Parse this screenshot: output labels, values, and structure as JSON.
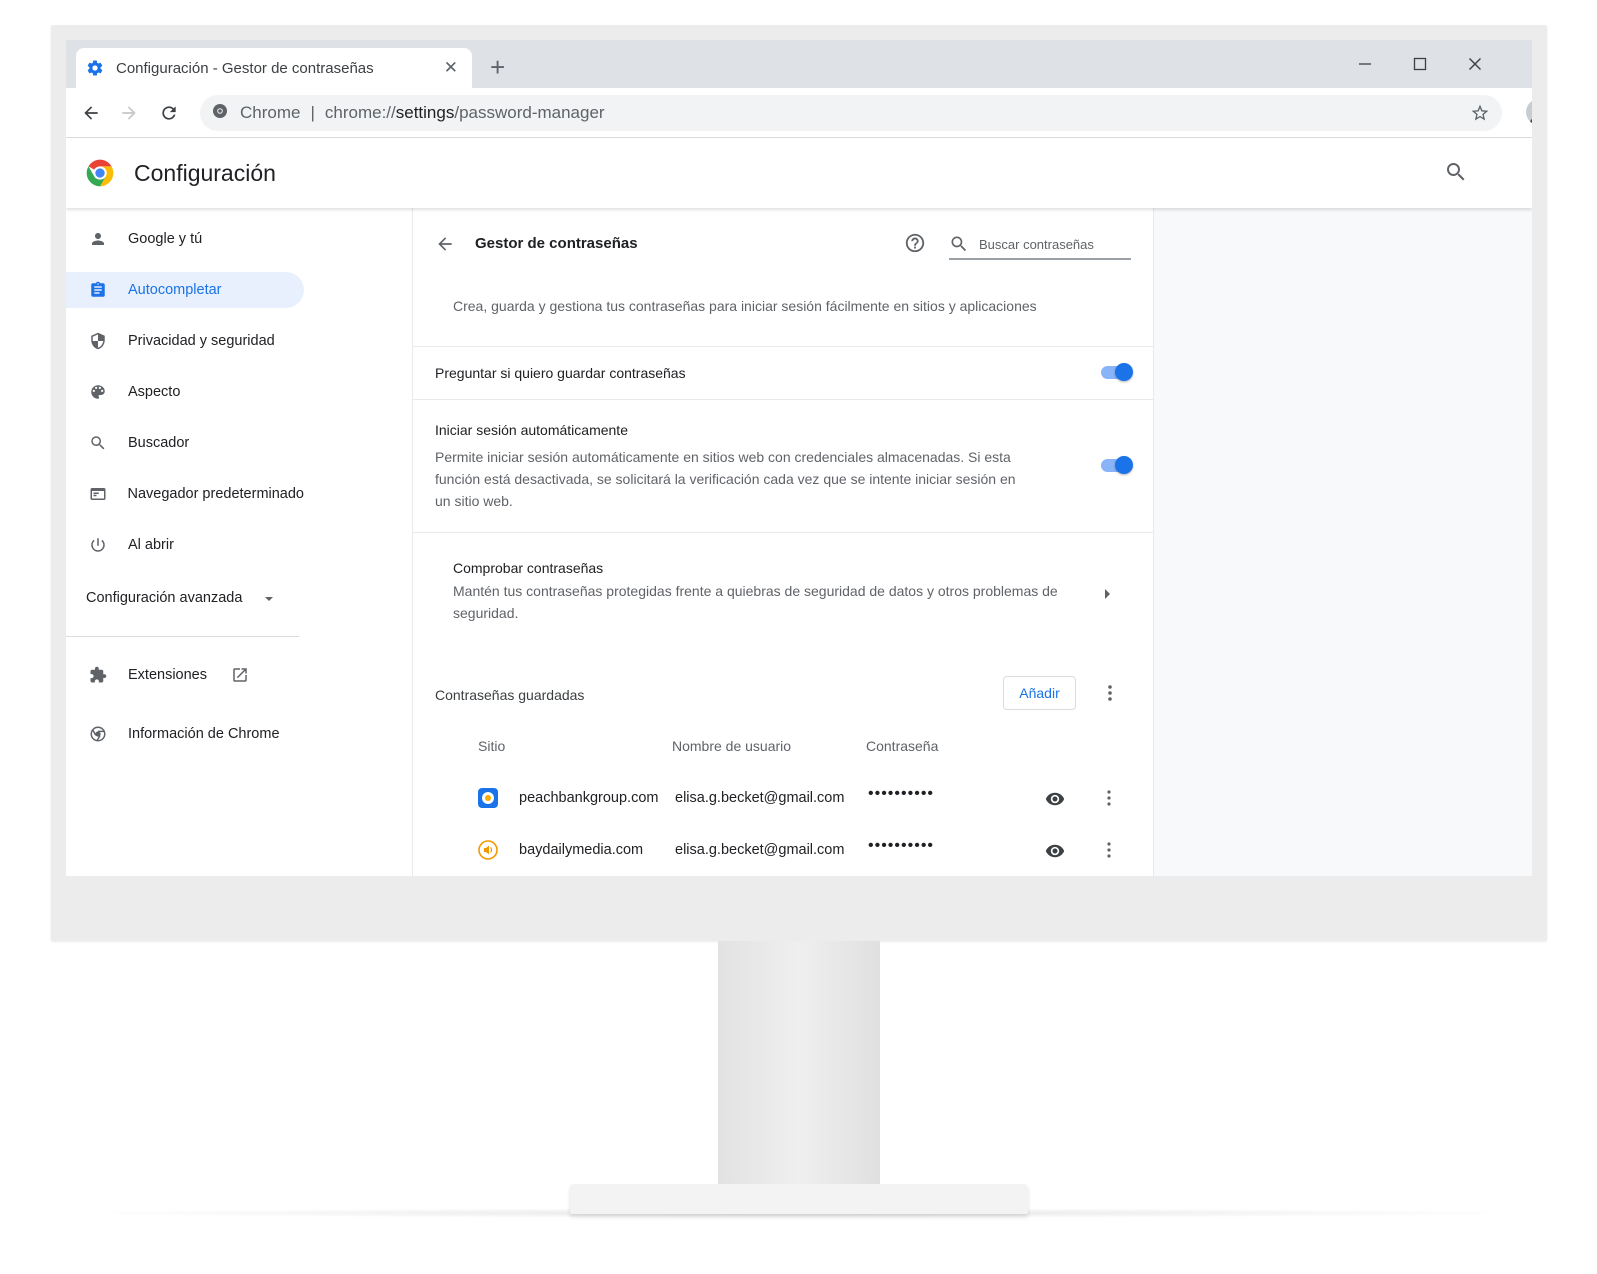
{
  "browser": {
    "tab_title": "Configuración - Gestor de contraseñas",
    "omnibox_label": "Chrome",
    "url_prefix": "chrome://",
    "url_host": "settings",
    "url_path": "/password-manager"
  },
  "settings": {
    "title": "Configuración"
  },
  "sidebar": {
    "items": [
      {
        "label": "Google y tú",
        "icon": "person-icon"
      },
      {
        "label": "Autocompletar",
        "icon": "clipboard-icon",
        "active": true
      },
      {
        "label": "Privacidad y seguridad",
        "icon": "shield-icon"
      },
      {
        "label": "Aspecto",
        "icon": "palette-icon"
      },
      {
        "label": "Buscador",
        "icon": "search-icon"
      },
      {
        "label": "Navegador predeterminado",
        "icon": "browser-window-icon"
      },
      {
        "label": "Al abrir",
        "icon": "power-icon"
      }
    ],
    "advanced_label": "Configuración avanzada",
    "extensions_label": "Extensiones",
    "about_label": "Información de Chrome"
  },
  "password_manager": {
    "title": "Gestor de contraseñas",
    "search_placeholder": "Buscar contraseñas",
    "intro": "Crea, guarda y gestiona tus contraseñas para iniciar sesión fácilmente en sitios y aplicaciones",
    "offer_to_save": {
      "label": "Preguntar si quiero guardar contraseñas",
      "enabled": true
    },
    "auto_signin": {
      "label": "Iniciar sesión automáticamente",
      "description_1": "Permite iniciar sesión automáticamente en sitios web con credenciales almacenadas. Si esta",
      "description_2": "función está desactivada, se solicitará la verificación cada vez que se intente iniciar sesión en",
      "description_3": "un sitio web.",
      "enabled": true
    },
    "check": {
      "label": "Comprobar contraseñas",
      "description_1": "Mantén tus contraseñas protegidas frente a quiebras de seguridad de datos y otros problemas de",
      "description_2": "seguridad."
    },
    "saved_title": "Contraseñas guardadas",
    "add_label": "Añadir",
    "columns": {
      "site": "Sitio",
      "username": "Nombre de usuario",
      "password": "Contraseña"
    },
    "rows": [
      {
        "site": "peachbankgroup.com",
        "username": "elisa.g.becket@gmail.com",
        "password": "••••••••••"
      },
      {
        "site": "baydailymedia.com",
        "username": "elisa.g.becket@gmail.com",
        "password": "••••••••••"
      }
    ]
  },
  "colors": {
    "accent": "#1a73e8",
    "accent_light": "#e8f0fe",
    "toggle_track": "#8ab4f8"
  }
}
